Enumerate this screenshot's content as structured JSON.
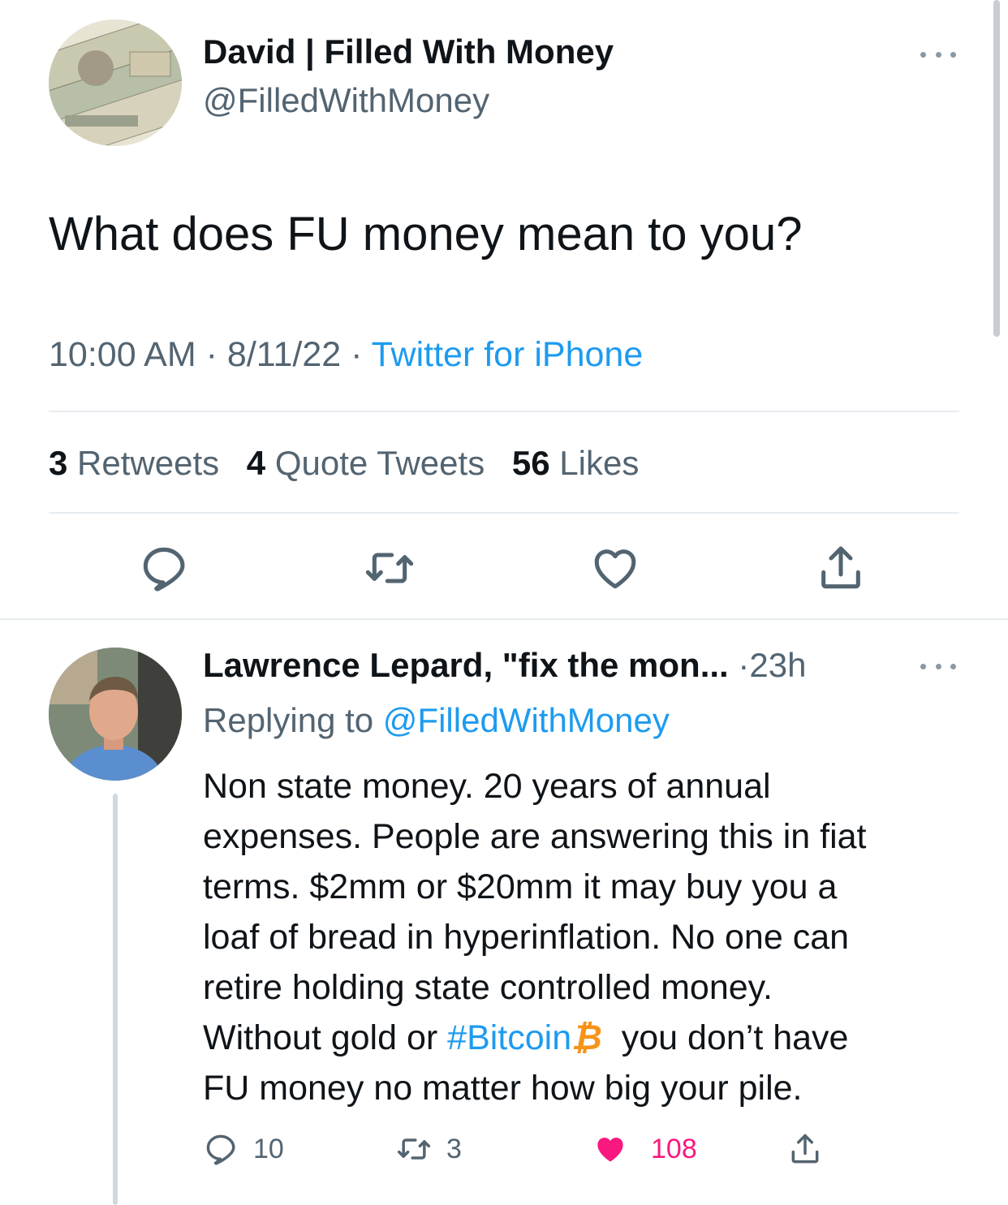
{
  "main_tweet": {
    "author_name": "David | Filled With Money",
    "author_handle": "@FilledWithMoney",
    "text": "What does FU money mean to you?",
    "time": "10:00 AM",
    "date": "8/11/22",
    "source": "Twitter for iPhone",
    "separator": "·",
    "stats": {
      "retweets_count": "3",
      "retweets_label": "Retweets",
      "quotes_count": "4",
      "quotes_label": "Quote Tweets",
      "likes_count": "56",
      "likes_label": "Likes"
    },
    "actions": [
      "reply-icon",
      "retweet-icon",
      "like-icon",
      "share-icon"
    ]
  },
  "reply": {
    "author_name": "Lawrence Lepard, \"fix the mon...",
    "age": "23h",
    "replying_prefix": "Replying to",
    "replying_handle": "@FilledWithMoney",
    "lines": [
      "Non state money.  20 years of annual",
      "expenses. People are answering this in fiat",
      "terms. $2mm or $20mm it may buy you a",
      "loaf of bread in hyperinflation. No one can",
      "retire holding state controlled money."
    ],
    "line6_prefix": "Without gold or ",
    "hashtag": "#Bitcoin",
    "bitcoin_symbol": "₿",
    "line6_suffix": "  you don’t have",
    "line7": "FU money no matter how big your pile.",
    "counts": {
      "replies": "10",
      "retweets": "3",
      "likes": "108"
    }
  },
  "colors": {
    "link": "#1d9bf0",
    "secondary_text": "#536471",
    "like_pink": "#f91880",
    "bitcoin_orange": "#f7931a"
  }
}
